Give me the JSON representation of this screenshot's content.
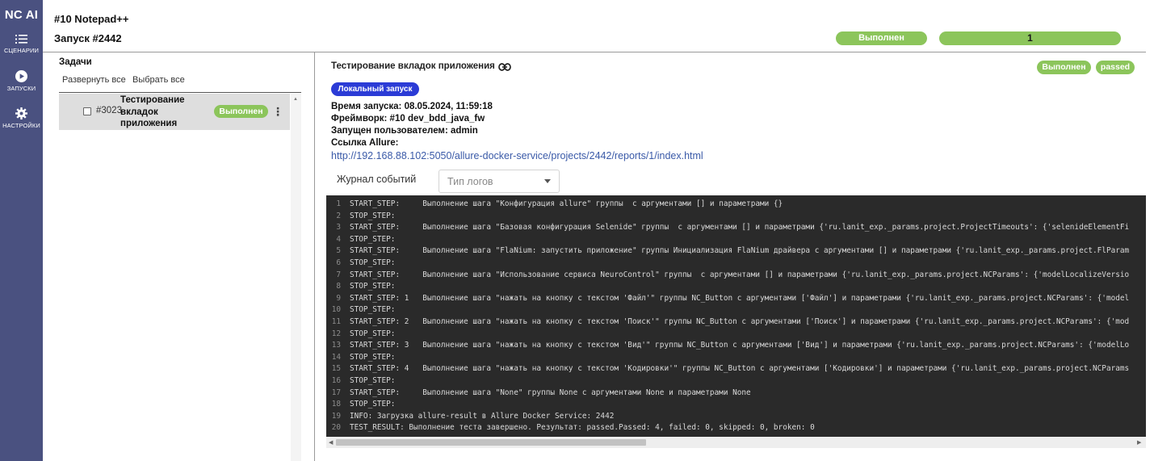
{
  "sidebar": {
    "brand": "NC AI",
    "items": [
      {
        "label": "СЦЕНАРИИ",
        "icon": "list-icon"
      },
      {
        "label": "ЗАПУСКИ",
        "icon": "play-icon"
      },
      {
        "label": "НАСТРОЙКИ",
        "icon": "gear-icon"
      }
    ]
  },
  "header": {
    "project": "#10 Notepad++",
    "run": "Запуск #2442",
    "status": "Выполнен",
    "count": "1"
  },
  "tasks": {
    "title": "Задачи",
    "expand_all": "Развернуть все",
    "select_all": "Выбрать все",
    "items": [
      {
        "id": "#3023",
        "name": "Тестирование вкладок приложения",
        "status": "Выполнен"
      }
    ]
  },
  "details": {
    "title": "Тестирование вкладок приложения",
    "status": "Выполнен",
    "result": "passed",
    "badge": "Локальный запуск",
    "start_time": "Время запуска: 08.05.2024, 11:59:18",
    "framework": "Фреймворк: #10 dev_bdd_java_fw",
    "user": "Запущен пользователем: admin",
    "allure_label": "Ссылка Allure:",
    "allure_url": "http://192.168.88.102:5050/allure-docker-service/projects/2442/reports/1/index.html",
    "journal_tab": "Журнал событий",
    "log_type_placeholder": "Тип логов"
  },
  "log": [
    {
      "n": "1",
      "text": "START_STEP:     Выполнение шага \"Конфигурация allure\" группы  с аргументами [] и параметрами {}"
    },
    {
      "n": "2",
      "text": "STOP_STEP:"
    },
    {
      "n": "3",
      "text": "START_STEP:     Выполнение шага \"Базовая конфигурация Selenide\" группы  с аргументами [] и параметрами {'ru.lanit_exp._params.project.ProjectTimeouts': {'selenideElementFi"
    },
    {
      "n": "4",
      "text": "STOP_STEP:"
    },
    {
      "n": "5",
      "text": "START_STEP:     Выполнение шага \"FlaNium: запустить приложение\" группы Инициализация FlaNium драйвера с аргументами [] и параметрами {'ru.lanit_exp._params.project.FlParam"
    },
    {
      "n": "6",
      "text": "STOP_STEP:"
    },
    {
      "n": "7",
      "text": "START_STEP:     Выполнение шага \"Использование сервиса NeuroControl\" группы  с аргументами [] и параметрами {'ru.lanit_exp._params.project.NCParams': {'modelLocalizeVersio"
    },
    {
      "n": "8",
      "text": "STOP_STEP:"
    },
    {
      "n": "9",
      "text": "START_STEP: 1   Выполнение шага \"нажать на кнопку с текстом 'Файл'\" группы NC_Button с аргументами ['Файл'] и параметрами {'ru.lanit_exp._params.project.NCParams': {'model"
    },
    {
      "n": "10",
      "text": "STOP_STEP:"
    },
    {
      "n": "11",
      "text": "START_STEP: 2   Выполнение шага \"нажать на кнопку с текстом 'Поиск'\" группы NC_Button с аргументами ['Поиск'] и параметрами {'ru.lanit_exp._params.project.NCParams': {'mod"
    },
    {
      "n": "12",
      "text": "STOP_STEP:"
    },
    {
      "n": "13",
      "text": "START_STEP: 3   Выполнение шага \"нажать на кнопку с текстом 'Вид'\" группы NC_Button с аргументами ['Вид'] и параметрами {'ru.lanit_exp._params.project.NCParams': {'modelLo"
    },
    {
      "n": "14",
      "text": "STOP_STEP:"
    },
    {
      "n": "15",
      "text": "START_STEP: 4   Выполнение шага \"нажать на кнопку с текстом 'Кодировки'\" группы NC_Button с аргументами ['Кодировки'] и параметрами {'ru.lanit_exp._params.project.NCParams"
    },
    {
      "n": "16",
      "text": "STOP_STEP:"
    },
    {
      "n": "17",
      "text": "START_STEP:     Выполнение шага \"None\" группы None с аргументами None и параметрами None"
    },
    {
      "n": "18",
      "text": "STOP_STEP:"
    },
    {
      "n": "19",
      "text": "INFO: Загрузка allure-result в Allure Docker Service: 2442"
    },
    {
      "n": "20",
      "text": "TEST_RESULT: Выполнение теста завершено. Результат: passed.Passed: 4, failed: 0, skipped: 0, broken: 0"
    }
  ],
  "colors": {
    "sidebar": "#4a5180",
    "success": "#8cc55b",
    "badge": "#2b3bd6",
    "console_bg": "#2a2a2a",
    "link": "#3a5aa8"
  }
}
